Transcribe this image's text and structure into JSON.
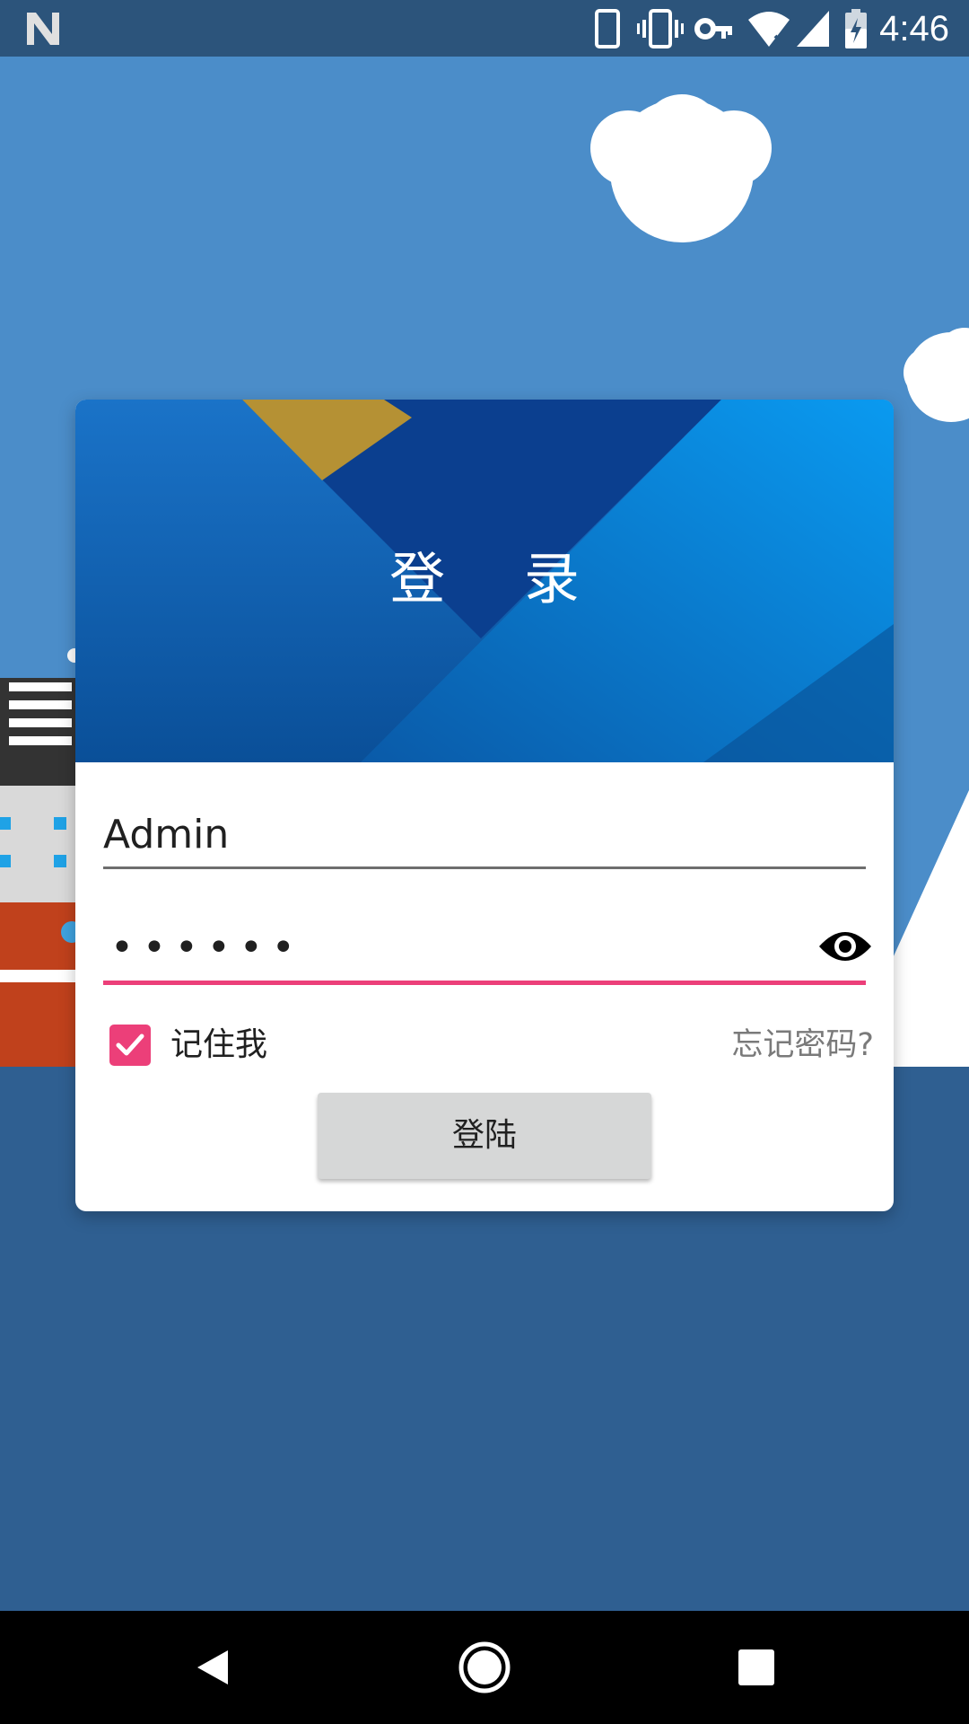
{
  "status_bar": {
    "time": "4:46",
    "icons": [
      "notification-n-icon",
      "phone-icon",
      "vibrate-icon",
      "vpn-key-icon",
      "wifi-icon",
      "signal-icon",
      "battery-icon"
    ]
  },
  "login": {
    "title": "登 录",
    "username_value": "Admin",
    "password_masked": "••••••",
    "password_visibility_icon": "eye-icon",
    "remember_me_label": "记住我",
    "remember_me_checked": true,
    "forgot_password_label": "忘记密码?",
    "login_button_label": "登陆"
  },
  "colors": {
    "sky": "#4b8dc9",
    "sea": "#2f5f91",
    "status_bar": "#2c547b",
    "accent": "#ec3f79",
    "header_blue": "#0d5fb3",
    "button_bg": "#d6d7d7"
  },
  "nav_bar": {
    "icons": [
      "back-icon",
      "home-icon",
      "recents-icon"
    ]
  }
}
